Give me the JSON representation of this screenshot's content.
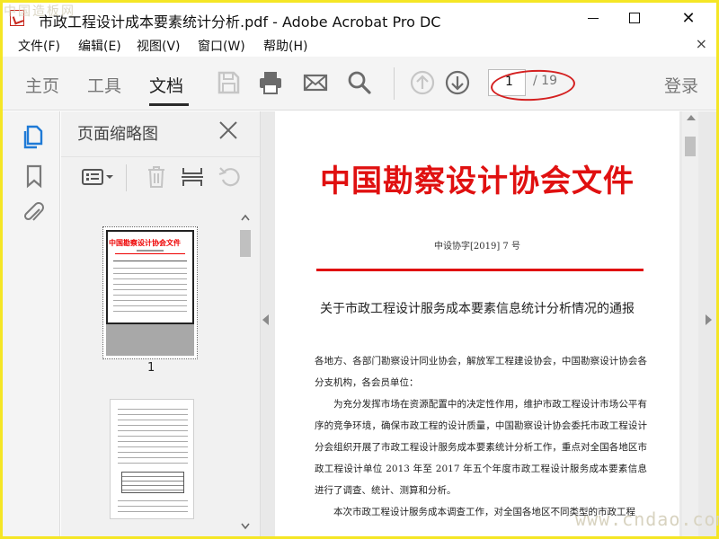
{
  "window": {
    "title": "市政工程设计成本要素统计分析.pdf - Adobe Acrobat Pro DC",
    "min": "",
    "max": "",
    "close": "✕"
  },
  "watermarks": {
    "top": "中国造板网",
    "bottom": "www.cndao.com"
  },
  "menu": {
    "items": [
      "文件(F)",
      "编辑(E)",
      "视图(V)",
      "窗口(W)",
      "帮助(H)"
    ],
    "close": "×"
  },
  "toolbar": {
    "tabs": [
      "主页",
      "工具",
      "文档"
    ],
    "active_tab": "文档",
    "icons": [
      "save-icon",
      "print-icon",
      "email-icon",
      "search-icon",
      "page-up-icon",
      "page-down-icon"
    ],
    "page_current": "1",
    "page_total": "/ 19",
    "login": "登录"
  },
  "rail": {
    "icons": [
      "page-thumbnails-icon",
      "bookmark-icon",
      "attachment-icon"
    ]
  },
  "thumbnails": {
    "title": "页面缩略图",
    "tool_icons": [
      "options-icon",
      "delete-icon",
      "extract-icon",
      "rotate-icon"
    ],
    "page1_header": "中国勘察设计协会文件",
    "page1_label": "1"
  },
  "document": {
    "header": "中国勘察设计协会文件",
    "number": "中设协字[2019] 7 号",
    "subject": "关于市政工程设计服务成本要素信息统计分析情况的通报",
    "p1": "各地方、各部门勘察设计同业协会，解放军工程建设协会，中国勘察设计协会各分支机构，各会员单位：",
    "p2": "为充分发挥市场在资源配置中的决定性作用，维护市政工程设计市场公平有序的竞争环境，确保市政工程的设计质量，中国勘察设计协会委托市政工程设计分会组织开展了市政工程设计服务成本要素统计分析工作，重点对全国各地区市政工程设计单位 2013 年至 2017 年五个年度市政工程设计服务成本要素信息进行了调查、统计、测算和分析。",
    "p3": "本次市政工程设计服务成本调查工作，对全国各地区不同类型的市政工程"
  },
  "colors": {
    "accent_red": "#e01010",
    "annotation_red": "#d42020",
    "frame_yellow": "#f5e625"
  }
}
